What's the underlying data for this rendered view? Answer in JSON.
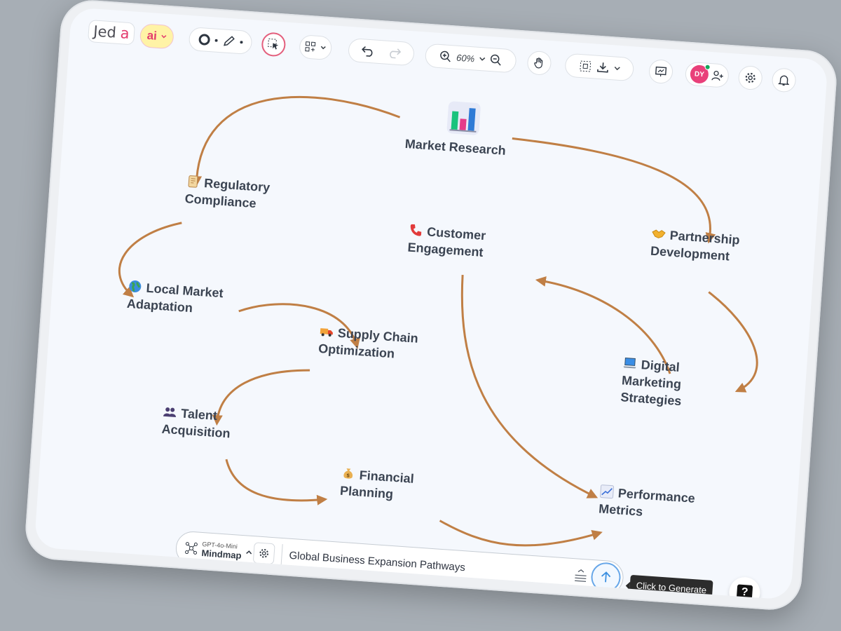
{
  "toolbar": {
    "logo_main": "Jed",
    "logo_accent": "a",
    "ai_label": "ai",
    "zoom_level": "60%",
    "user_initials": "DY"
  },
  "icons": {
    "ai": "ai-sparkle-icon",
    "shape": "circle-shape-icon",
    "pen": "pencil-icon",
    "select": "cursor-select-icon",
    "layout": "layout-grid-icon",
    "undo": "undo-icon",
    "redo": "redo-icon",
    "zoom_in": "zoom-in-icon",
    "zoom_out": "zoom-out-icon",
    "hand": "hand-pan-icon",
    "capture": "screen-capture-icon",
    "download": "download-icon",
    "present": "present-icon",
    "add_user": "add-user-icon",
    "settings": "gear-icon",
    "bell": "bell-icon",
    "mindmap": "mindmap-icon",
    "send": "arrow-up-icon",
    "help": "help-icon"
  },
  "mindmap": {
    "root": "Market Research",
    "nodes": [
      {
        "id": "regulatory",
        "line1": "Regulatory",
        "line2": "Compliance",
        "emoji": "scroll"
      },
      {
        "id": "local",
        "line1": "Local Market",
        "line2": "Adaptation",
        "emoji": "globe"
      },
      {
        "id": "supply",
        "line1": "Supply Chain",
        "line2": "Optimization",
        "emoji": "truck"
      },
      {
        "id": "talent",
        "line1": "Talent",
        "line2": "Acquisition",
        "emoji": "people"
      },
      {
        "id": "finance",
        "line1": "Financial",
        "line2": "Planning",
        "emoji": "money-bag"
      },
      {
        "id": "customer",
        "line1": "Customer",
        "line2": "Engagement",
        "emoji": "phone"
      },
      {
        "id": "partner",
        "line1": "Partnership",
        "line2": "Development",
        "emoji": "handshake"
      },
      {
        "id": "digital",
        "line1": "Digital",
        "line2": "Marketing",
        "line3": "Strategies",
        "emoji": "laptop"
      },
      {
        "id": "metrics",
        "line1": "Performance",
        "line2": "Metrics",
        "emoji": "chart"
      }
    ],
    "edge_color": "#c07f45"
  },
  "prompt": {
    "model": "GPT-4o-Mini",
    "mode": "Mindmap",
    "text": "Global Business Expansion Pathways",
    "tooltip": "Click to Generate",
    "help": "?"
  }
}
